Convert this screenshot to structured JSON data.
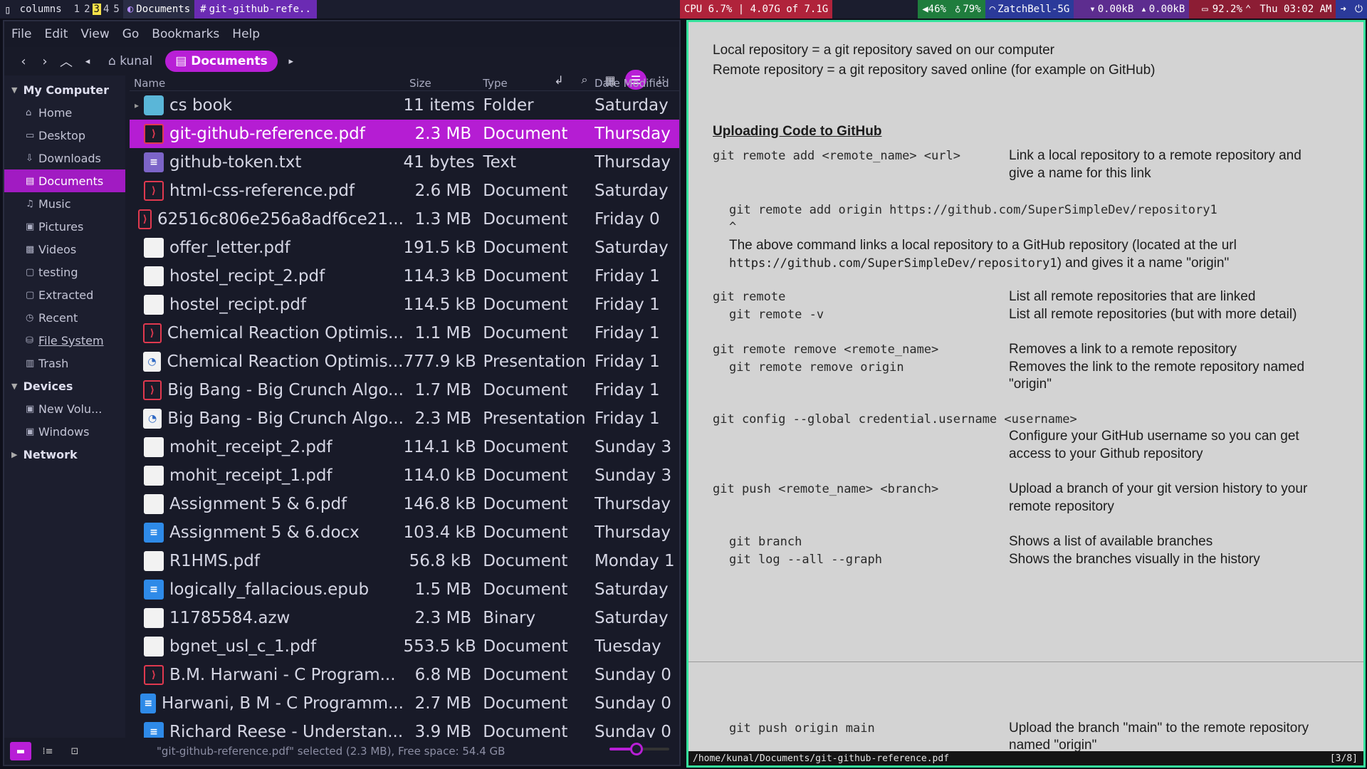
{
  "topbar": {
    "layout": "columns",
    "workspaces": [
      "1",
      "2",
      "3",
      "4",
      "5"
    ],
    "active_workspace": "3",
    "window1": "Documents",
    "window2": "git-github-refe..",
    "cpu": "CPU 6.7% | 4.07G of 7.1G",
    "volume": "46%",
    "brightness": "79%",
    "wifi": "ZatchBell-5G",
    "down": "0.00kB",
    "up": "0.00kB",
    "battery": "92.2%",
    "clock": "Thu 03:02 AM"
  },
  "filemanager": {
    "menu": [
      "File",
      "Edit",
      "View",
      "Go",
      "Bookmarks",
      "Help"
    ],
    "breadcrumb": {
      "parent": "kunal",
      "current": "Documents"
    },
    "columns": {
      "name": "Name",
      "size": "Size",
      "type": "Type",
      "date": "Date Modified"
    },
    "sidebar": {
      "sections": [
        {
          "title": "My Computer",
          "items": [
            {
              "label": "Home",
              "icon": "home-icon"
            },
            {
              "label": "Desktop",
              "icon": "desktop-icon"
            },
            {
              "label": "Downloads",
              "icon": "download-icon"
            },
            {
              "label": "Documents",
              "icon": "documents-icon",
              "active": true
            },
            {
              "label": "Music",
              "icon": "music-icon"
            },
            {
              "label": "Pictures",
              "icon": "pictures-icon"
            },
            {
              "label": "Videos",
              "icon": "videos-icon"
            },
            {
              "label": "testing",
              "icon": "folder-icon"
            },
            {
              "label": "Extracted",
              "icon": "folder-icon"
            },
            {
              "label": "Recent",
              "icon": "recent-icon"
            },
            {
              "label": "File System",
              "icon": "filesystem-icon"
            },
            {
              "label": "Trash",
              "icon": "trash-icon"
            }
          ]
        },
        {
          "title": "Devices",
          "items": [
            {
              "label": "New Volu...",
              "icon": "drive-icon"
            },
            {
              "label": "Windows",
              "icon": "drive-icon"
            }
          ]
        },
        {
          "title": "Network",
          "items": []
        }
      ]
    },
    "files": [
      {
        "name": "cs book",
        "size": "11 items",
        "type": "Folder",
        "date": "Saturday",
        "kind": "folder"
      },
      {
        "name": "git-github-reference.pdf",
        "size": "2.3 MB",
        "type": "Document",
        "date": "Thursday",
        "kind": "pdf",
        "selected": true
      },
      {
        "name": "github-token.txt",
        "size": "41 bytes",
        "type": "Text",
        "date": "Thursday",
        "kind": "txt"
      },
      {
        "name": "html-css-reference.pdf",
        "size": "2.6 MB",
        "type": "Document",
        "date": "Saturday",
        "kind": "pdf"
      },
      {
        "name": "62516c806e256a8adf6ce21...",
        "size": "1.3 MB",
        "type": "Document",
        "date": "Friday 0",
        "kind": "pdf"
      },
      {
        "name": "offer_letter.pdf",
        "size": "191.5 kB",
        "type": "Document",
        "date": "Saturday",
        "kind": "blank"
      },
      {
        "name": "hostel_recipt_2.pdf",
        "size": "114.3 kB",
        "type": "Document",
        "date": "Friday 1",
        "kind": "blank"
      },
      {
        "name": "hostel_recipt.pdf",
        "size": "114.5 kB",
        "type": "Document",
        "date": "Friday 1",
        "kind": "blank"
      },
      {
        "name": "Chemical Reaction Optimis...",
        "size": "1.1 MB",
        "type": "Document",
        "date": "Friday 1",
        "kind": "pdf"
      },
      {
        "name": "Chemical Reaction Optimis...",
        "size": "777.9 kB",
        "type": "Presentation",
        "date": "Friday 1",
        "kind": "ppt"
      },
      {
        "name": "Big Bang - Big Crunch Algo...",
        "size": "1.7 MB",
        "type": "Document",
        "date": "Friday 1",
        "kind": "pdf"
      },
      {
        "name": "Big Bang - Big Crunch Algo...",
        "size": "2.3 MB",
        "type": "Presentation",
        "date": "Friday 1",
        "kind": "ppt"
      },
      {
        "name": "mohit_receipt_2.pdf",
        "size": "114.1 kB",
        "type": "Document",
        "date": "Sunday 3",
        "kind": "blank"
      },
      {
        "name": "mohit_receipt_1.pdf",
        "size": "114.0 kB",
        "type": "Document",
        "date": "Sunday 3",
        "kind": "blank"
      },
      {
        "name": "Assignment 5 & 6.pdf",
        "size": "146.8 kB",
        "type": "Document",
        "date": "Thursday",
        "kind": "blank"
      },
      {
        "name": "Assignment 5 & 6.docx",
        "size": "103.4 kB",
        "type": "Document",
        "date": "Thursday",
        "kind": "doc"
      },
      {
        "name": "R1HMS.pdf",
        "size": "56.8 kB",
        "type": "Document",
        "date": "Monday 1",
        "kind": "blank"
      },
      {
        "name": "logically_fallacious.epub",
        "size": "1.5 MB",
        "type": "Document",
        "date": "Saturday",
        "kind": "doc"
      },
      {
        "name": "11785584.azw",
        "size": "2.3 MB",
        "type": "Binary",
        "date": "Saturday",
        "kind": "blank"
      },
      {
        "name": "bgnet_usl_c_1.pdf",
        "size": "553.5 kB",
        "type": "Document",
        "date": "Tuesday",
        "kind": "blank"
      },
      {
        "name": "B.M. Harwani - C Program...",
        "size": "6.8 MB",
        "type": "Document",
        "date": "Sunday 0",
        "kind": "pdf"
      },
      {
        "name": "Harwani, B M - C Programm...",
        "size": "2.7 MB",
        "type": "Document",
        "date": "Sunday 0",
        "kind": "doc"
      },
      {
        "name": "Richard Reese - Understan...",
        "size": "3.9 MB",
        "type": "Document",
        "date": "Sunday 0",
        "kind": "doc"
      }
    ],
    "status": "\"git-github-reference.pdf\" selected (2.3 MB), Free space: 54.4 GB",
    "zoom_level": 0.45
  },
  "pdf": {
    "intro1": "Local repository = a git repository saved on our computer",
    "intro2": "Remote repository = a git repository saved online (for example on GitHub)",
    "heading": "Uploading Code to GitHub",
    "cmd1": "git remote add <remote_name> <url>",
    "desc1a": "Link a local repository to a remote repository and",
    "desc1b": "give a name for this link",
    "example1": "git remote add origin https://github.com/SuperSimpleDev/repository1",
    "caret": "^",
    "explain1": "The above command links a local repository to a GitHub repository (located at the url",
    "explain2_url": "https://github.com/SuperSimpleDev/repository1",
    "explain2_rest": ") and gives it a name \"origin\"",
    "cmd2": "git remote",
    "desc2": "List all remote repositories that are linked",
    "cmd2b": "git remote -v",
    "desc2b": "List all remote repositories (but with more detail)",
    "cmd3": "git remote remove <remote_name>",
    "desc3": "Removes a link to a remote repository",
    "cmd3b": "git remote remove origin",
    "desc3b1": "Removes the link to the remote repository named",
    "desc3b2": "\"origin\"",
    "cmd4": "git config --global credential.username <username>",
    "desc4a": "Configure your GitHub username so you can get",
    "desc4b": "access to your Github repository",
    "cmd5": "git push <remote_name> <branch>",
    "desc5a": "Upload a branch of your git version history to your",
    "desc5b": "remote repository",
    "cmd6": "git branch",
    "desc6": "Shows a list of available branches",
    "cmd7": "git log --all --graph",
    "desc7": "Shows the branches visually in the history",
    "cmd8": "git push origin main",
    "desc8a": "Upload the branch \"main\" to the remote repository",
    "desc8b": "named \"origin\"",
    "path": "/home/kunal/Documents/git-github-reference.pdf",
    "page": "[3/8]"
  },
  "colors": {
    "accent": "#b81fd6",
    "pdf_border": "#36e39d",
    "pdf_bg": "#d3d3d3"
  }
}
